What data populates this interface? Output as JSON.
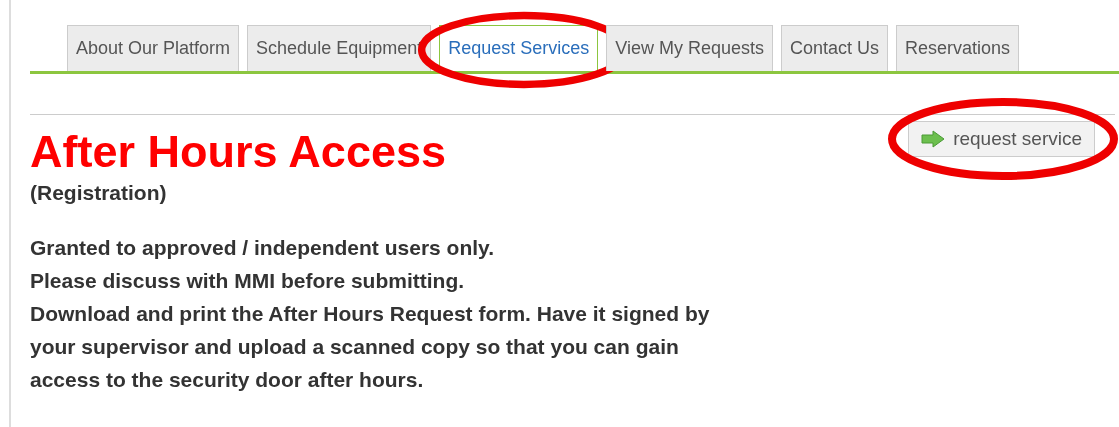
{
  "tabs": [
    {
      "label": "About Our Platform",
      "selected": false,
      "circled": false
    },
    {
      "label": "Schedule Equipment",
      "selected": false,
      "circled": false
    },
    {
      "label": "Request Services",
      "selected": true,
      "circled": true
    },
    {
      "label": "View My Requests",
      "selected": false,
      "circled": false
    },
    {
      "label": "Contact Us",
      "selected": false,
      "circled": false
    },
    {
      "label": "Reservations",
      "selected": false,
      "circled": false
    }
  ],
  "button": {
    "label": "request service",
    "circled": true
  },
  "heading": "After Hours Access",
  "subheading": "(Registration)",
  "paragraphs": [
    "Granted to approved / independent users only.",
    "Please discuss with MMI before submitting.",
    "Download and print the After Hours Request form. Have it signed by your supervisor and upload a scanned copy so that you can gain access to the security door after hours."
  ]
}
